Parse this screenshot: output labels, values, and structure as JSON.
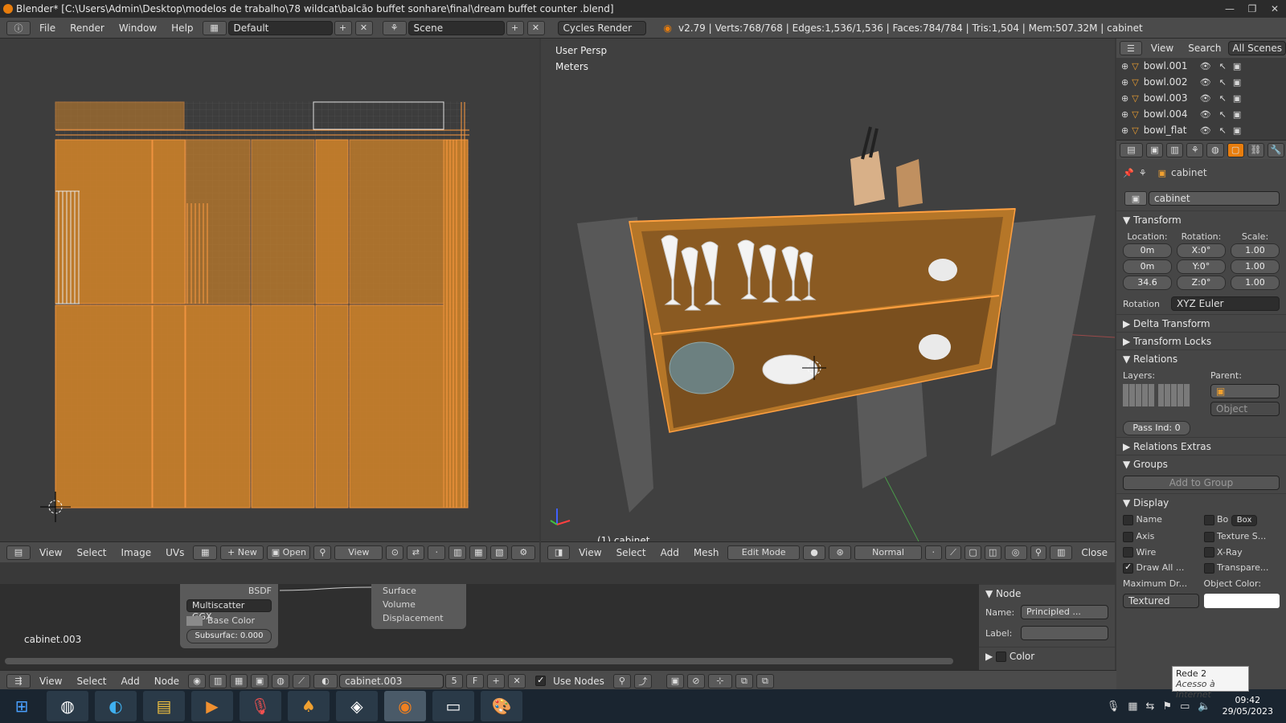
{
  "window": {
    "title": "Blender* [C:\\Users\\Admin\\Desktop\\modelos de trabalho\\78 wildcat\\balcão buffet sonhare\\final\\dream buffet counter .blend]",
    "controls": [
      "—",
      "❐",
      "✕"
    ]
  },
  "topbar": {
    "menus": [
      "File",
      "Render",
      "Window",
      "Help"
    ],
    "layout": "Default",
    "scene": "Scene",
    "engine": "Cycles Render",
    "stats": "v2.79 | Verts:768/768 | Edges:1,536/1,536 | Faces:784/784 | Tris:1,504 | Mem:507.32M | cabinet"
  },
  "uv_editor": {
    "header_menus": [
      "View",
      "Select",
      "Image",
      "UVs"
    ],
    "new_label": "New",
    "open_label": "Open",
    "view_label": "View"
  },
  "viewport": {
    "persp_label": "User Persp",
    "units_label": "Meters",
    "object_label": "(1) cabinet",
    "header_menus": [
      "View",
      "Select",
      "Add",
      "Mesh"
    ],
    "mode": "Edit Mode",
    "orientation": "Normal",
    "close_label": "Close"
  },
  "outliner": {
    "view_label": "View",
    "search_label": "Search",
    "scenes_label": "All Scenes",
    "items": [
      "bowl.001",
      "bowl.002",
      "bowl.003",
      "bowl.004",
      "bowl_flat"
    ]
  },
  "properties": {
    "breadcrumb": "cabinet",
    "object_name": "cabinet",
    "transform_title": "Transform",
    "location_label": "Location:",
    "rotation_label": "Rotation:",
    "scale_label": "Scale:",
    "location": [
      "0m",
      "0m",
      "34.6"
    ],
    "rotation": [
      "X:0°",
      "Y:0°",
      "Z:0°"
    ],
    "scale": [
      "1.00",
      "1.00",
      "1.00"
    ],
    "rotation_mode_label": "Rotation",
    "rotation_mode": "XYZ Euler",
    "delta_transform": "Delta Transform",
    "transform_locks": "Transform Locks",
    "relations": "Relations",
    "layers_label": "Layers:",
    "parent_label": "Parent:",
    "parent_type": "Object",
    "pass_index": "Pass Ind: 0",
    "relations_extras": "Relations Extras",
    "groups": "Groups",
    "add_to_group": "Add to Group",
    "display": "Display",
    "display_options": [
      {
        "label": "Name",
        "checked": false
      },
      {
        "label": "Bo",
        "checked": false
      },
      {
        "label": "Axis",
        "checked": false
      },
      {
        "label": "Texture S...",
        "checked": false
      },
      {
        "label": "Wire",
        "checked": false
      },
      {
        "label": "X-Ray",
        "checked": false
      },
      {
        "label": "Draw All ...",
        "checked": true
      },
      {
        "label": "Transpare...",
        "checked": false
      }
    ],
    "bounds_type": "Box",
    "max_draw_label": "Maximum Dr...",
    "object_color_label": "Object Color:",
    "max_draw_value": "Textured"
  },
  "node_editor": {
    "material_name": "cabinet.003",
    "bsdf_label": "BSDF",
    "distribution": "Multiscatter GGX",
    "base_color": "Base Color",
    "subsurface": "Subsurfac: 0.000",
    "output_sockets": [
      "Surface",
      "Volume",
      "Displacement"
    ],
    "header_menus": [
      "View",
      "Select",
      "Add",
      "Node"
    ],
    "material_field": "cabinet.003",
    "users": "5",
    "fake_user": "F",
    "use_nodes_label": "Use Nodes",
    "side_node_title": "Node",
    "side_name_label": "Name:",
    "side_name_value": "Principled ...",
    "side_label_label": "Label:",
    "side_color_title": "Color"
  },
  "tooltip": {
    "line1": "Rede 2",
    "line2": "Acesso à Internet"
  },
  "taskbar": {
    "time": "09:42",
    "date": "29/05/2023"
  },
  "colors": {
    "accent": "#e87d0d",
    "uv_face": "#c8802a",
    "background": "#393939"
  }
}
